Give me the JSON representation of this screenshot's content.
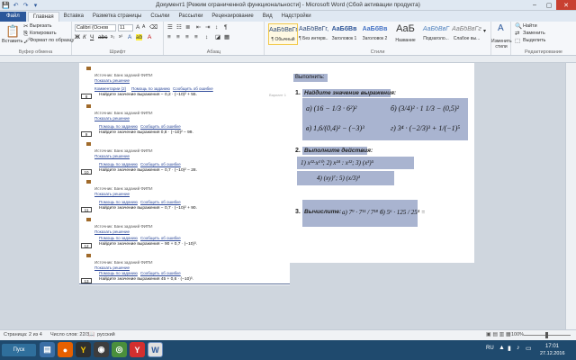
{
  "window": {
    "title": "Документ1 [Режим ограниченной функциональности] - Microsoft Word (Сбой активации продукта)",
    "minimize": "–",
    "maximize": "▢",
    "close": "✕"
  },
  "qat": {
    "save": "💾",
    "undo": "↶",
    "redo": "↷",
    "customize": "▾"
  },
  "tabs": [
    "Файл",
    "Главная",
    "Вставка",
    "Разметка страницы",
    "Ссылки",
    "Рассылки",
    "Рецензирование",
    "Вид",
    "Надстройки"
  ],
  "ribbon": {
    "clipboard": {
      "paste": "Вставить",
      "cut": "Вырезать",
      "copy": "Копировать",
      "format_painter": "Формат по образцу",
      "label": "Буфер обмена"
    },
    "font": {
      "name": "Calibri (Основ",
      "size": "11",
      "label": "Шрифт"
    },
    "paragraph": {
      "label": "Абзац"
    },
    "styles": {
      "items": [
        {
          "sample": "АаБбВвГг,",
          "name": "¶ Обычный"
        },
        {
          "sample": "АаБбВвГг,",
          "name": "¶ Без интерв..."
        },
        {
          "sample": "АаБбВв",
          "name": "Заголовок 1"
        },
        {
          "sample": "АаБбВв",
          "name": "Заголовок 2"
        },
        {
          "sample": "АаБ",
          "name": "Название"
        },
        {
          "sample": "АаБбВвГ",
          "name": "Подзаголо..."
        },
        {
          "sample": "АаБбВвГг",
          "name": "Слабое вы..."
        }
      ],
      "change": "Изменить стили",
      "label": "Стили"
    },
    "editing": {
      "find": "Найти",
      "replace": "Заменить",
      "select": "Выделить",
      "label": "Редактирование"
    }
  },
  "left_page": {
    "rows": [
      {
        "num": "",
        "source": "Источник: Банк заданий ФИПИ",
        "show": "Показать решение",
        "links": [],
        "task": ""
      },
      {
        "num": "8",
        "source": "Комментарии (2)",
        "show": "",
        "links": [
          "Помощь по заданию",
          "Сообщить об ошибке"
        ],
        "task": "Найдите значение выражения  − 0,2 · (−10)² + 55."
      },
      {
        "num": "",
        "source": "Источник: Банк заданий ФИПИ",
        "show": "Показать решение",
        "links": [],
        "task": ""
      },
      {
        "num": "9",
        "source": "",
        "show": "",
        "links": [
          "Помощь по заданию",
          "Сообщить об ошибке"
        ],
        "task": "Найдите значение выражения  0,8 · (−10)² − 99."
      },
      {
        "num": "",
        "source": "Источник: Банк заданий ФИПИ",
        "show": "Показать решение",
        "links": [],
        "task": ""
      },
      {
        "num": "10",
        "source": "",
        "show": "",
        "links": [
          "Помощь по заданию",
          "Сообщить об ошибке"
        ],
        "task": "Найдите значение выражения  − 0,7 · (−10)² − 28."
      },
      {
        "num": "",
        "source": "Источник: Банк заданий ФИПИ",
        "show": "Показать решение",
        "links": [],
        "task": ""
      },
      {
        "num": "11",
        "source": "",
        "show": "",
        "links": [
          "Помощь по заданию",
          "Сообщить об ошибке"
        ],
        "task": "Найдите значение выражения  − 0,7 · (−10)² + 90."
      },
      {
        "num": "",
        "source": "Источник: Банк заданий ФИПИ",
        "show": "Показать решение",
        "links": [],
        "task": ""
      },
      {
        "num": "12",
        "source": "",
        "show": "",
        "links": [
          "Помощь по заданию",
          "Сообщить об ошибке"
        ],
        "task": "Найдите значение выражения  − 90 + 0,7 · (−10)³."
      },
      {
        "num": "",
        "source": "Источник: Банк заданий ФИПИ",
        "show": "Показать решение",
        "links": [],
        "task": ""
      },
      {
        "num": "13",
        "source": "",
        "show": "",
        "links": [
          "Помощь по заданию",
          "Сообщить об ошибке"
        ],
        "task": "Найдите значение выражения  45 + 0,6 · (−10)³."
      }
    ],
    "margin_note": "Вариант 1"
  },
  "right_page": {
    "header": "Выполнить:",
    "item1_title": "Найдите значение выражения:",
    "item1_a": "а) (16 − 1/3 · 6²)²",
    "item1_b": "б) (3/4)² · 1 1/3 − (0,5)²",
    "item1_c": "в) 1,6/(0,4)² − (−3)³",
    "item1_d": "г) 3⁴ · (−2/3)³ + 1/(−1)⁵",
    "item2_title": "Выполните действия:",
    "item2_line1": "1)  x¹²·x¹⁰;     2)  x²⁴ : x¹²;     3)  (x³)⁵",
    "item2_line2": "4)  (xy)⁷;     5)  (x/3)³",
    "item3_title": "Вычислите:",
    "item3_a": "а)  7⁹ · 7¹¹ / 7¹⁸ =",
    "item3_b": "б)  5⁶ · 125 / 25⁴ =",
    "num1": "1.",
    "num2": "2.",
    "num3": "3."
  },
  "status": {
    "page": "Страница: 2 из 4",
    "words": "Число слов: 22/38",
    "lang": "русский",
    "zoom": "100%"
  },
  "taskbar": {
    "start": "Пуск",
    "apps": [
      "explorer",
      "firefox",
      "yandex",
      "yandex-browser",
      "chrome",
      "yandex-y",
      "word"
    ],
    "lang": "RU",
    "time": "17:01",
    "date": "27.12.2016"
  }
}
